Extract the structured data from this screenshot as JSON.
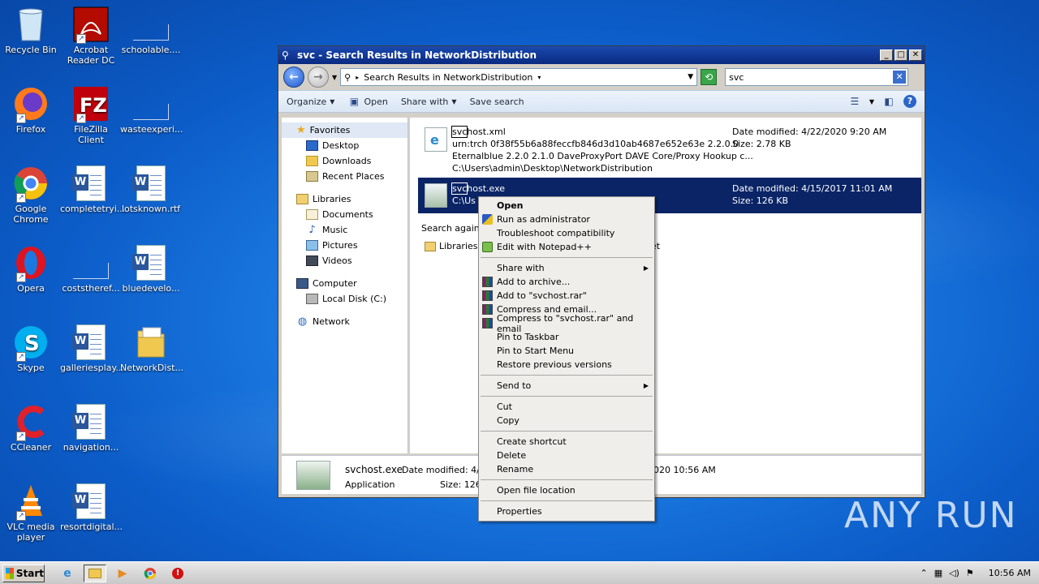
{
  "desktop": {
    "icons": [
      {
        "label": "Recycle Bin"
      },
      {
        "label": "Acrobat Reader DC"
      },
      {
        "label": "schoolable...."
      },
      {
        "label": "Firefox"
      },
      {
        "label": "FileZilla Client"
      },
      {
        "label": "wasteexperi..."
      },
      {
        "label": "Google Chrome"
      },
      {
        "label": "completetryi..."
      },
      {
        "label": "lotsknown.rtf"
      },
      {
        "label": "Opera"
      },
      {
        "label": "coststheref..."
      },
      {
        "label": "bluedevelo..."
      },
      {
        "label": "Skype"
      },
      {
        "label": "galleriesplay..."
      },
      {
        "label": "NetworkDist..."
      },
      {
        "label": "CCleaner"
      },
      {
        "label": "navigation..."
      },
      {
        "label": "VLC media player"
      },
      {
        "label": "resortdigital..."
      }
    ]
  },
  "window": {
    "title": "svc - Search Results in NetworkDistribution",
    "address": "Search Results in NetworkDistribution",
    "search_value": "svc",
    "toolbar": {
      "organize": "Organize",
      "open": "Open",
      "share_with": "Share with",
      "save_search": "Save search"
    },
    "nav": {
      "favorites": "Favorites",
      "desktop": "Desktop",
      "downloads": "Downloads",
      "recent_places": "Recent Places",
      "libraries": "Libraries",
      "documents": "Documents",
      "music": "Music",
      "pictures": "Pictures",
      "videos": "Videos",
      "computer": "Computer",
      "local_disk": "Local Disk (C:)",
      "network": "Network"
    },
    "results": [
      {
        "name_hl": "svc",
        "name_rest": "host.xml",
        "line2": "urn:trch 0f38f55b6a88feccfb846d3d10ab4687e652e63e 2.2.0.0",
        "line3": "Eternalblue 2.2.0 2.1.0 DaveProxyPort DAVE Core/Proxy Hookup c...",
        "path": "C:\\Users\\admin\\Desktop\\NetworkDistribution",
        "date": "Date modified: 4/22/2020 9:20 AM",
        "size": "Size: 2.78 KB"
      },
      {
        "name_hl": "svc",
        "name_rest": "host.exe",
        "path": "C:\\Us",
        "date": "Date modified: 4/15/2017 11:01 AM",
        "size": "Size: 126 KB"
      }
    ],
    "search_again": "Search again i",
    "search_again_lib": "Libraries",
    "search_again_tail": "et",
    "details": {
      "name": "svchost.exe",
      "date_label": "Date modified: 4/15",
      "type": "Application",
      "size_label": "Size: 126 I",
      "created_tail": "020 10:56 AM"
    }
  },
  "context_menu": {
    "open": "Open",
    "run_as_admin": "Run as administrator",
    "troubleshoot": "Troubleshoot compatibility",
    "edit_npp": "Edit with Notepad++",
    "share_with": "Share with",
    "add_archive": "Add to archive...",
    "add_rar": "Add to \"svchost.rar\"",
    "compress_email": "Compress and email...",
    "compress_rar_email": "Compress to \"svchost.rar\" and email",
    "pin_taskbar": "Pin to Taskbar",
    "pin_start": "Pin to Start Menu",
    "restore_prev": "Restore previous versions",
    "send_to": "Send to",
    "cut": "Cut",
    "copy": "Copy",
    "create_shortcut": "Create shortcut",
    "delete": "Delete",
    "rename": "Rename",
    "open_location": "Open file location",
    "properties": "Properties"
  },
  "taskbar": {
    "start": "Start",
    "clock": "10:56 AM"
  },
  "watermark": "ANY RUN"
}
